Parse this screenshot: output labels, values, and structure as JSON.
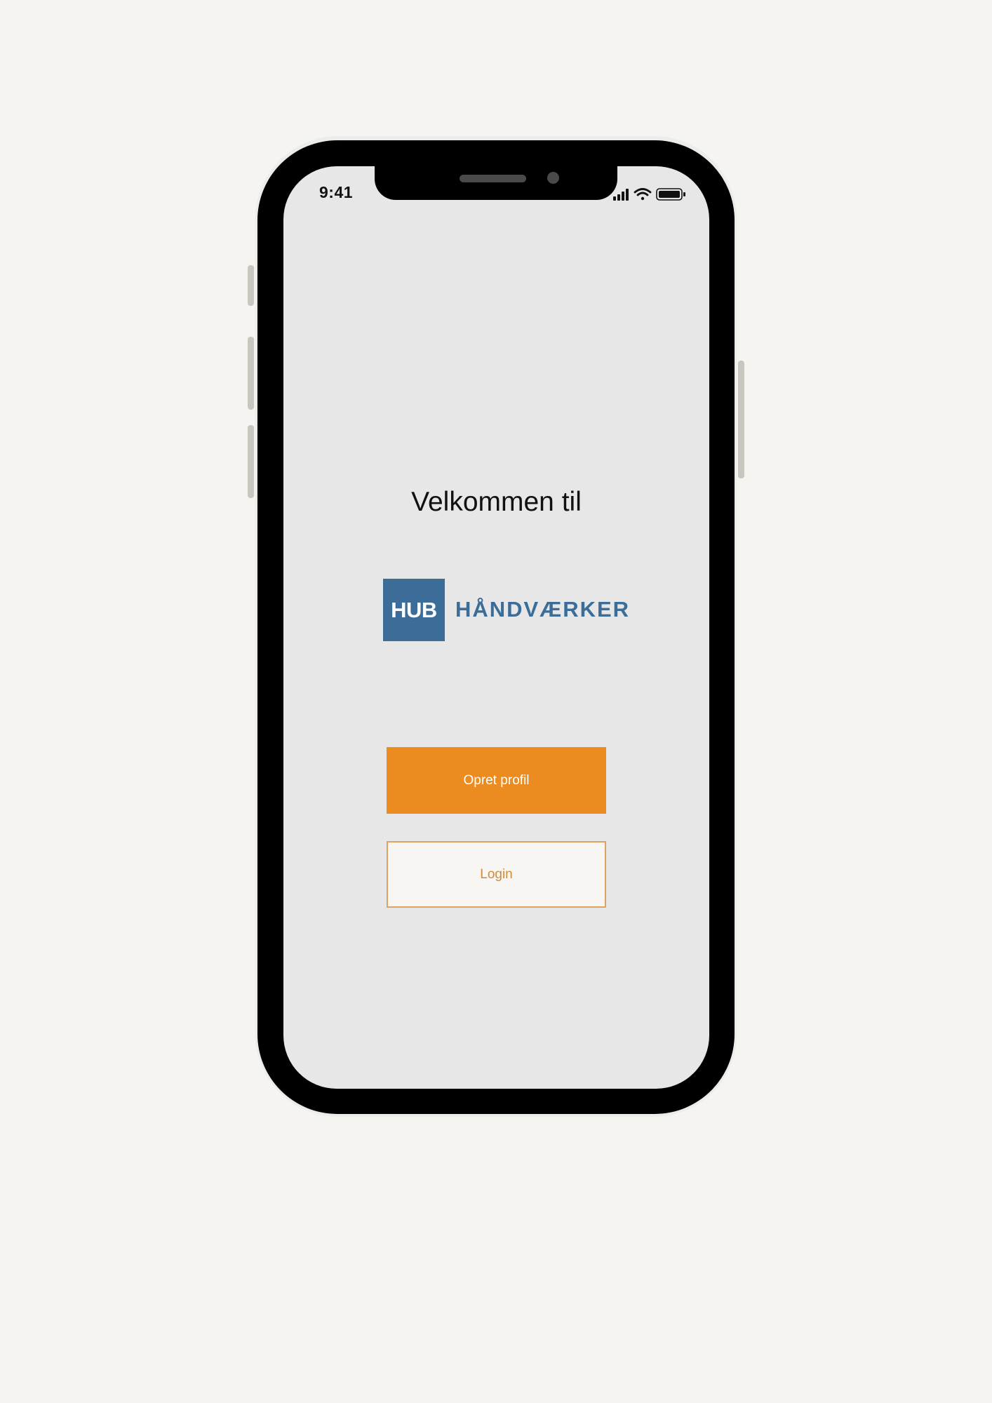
{
  "status_bar": {
    "time": "9:41",
    "icons": [
      "signal-icon",
      "wifi-icon",
      "battery-icon"
    ]
  },
  "welcome": {
    "title": "Velkommen til"
  },
  "logo": {
    "mark": "HUB",
    "wordmark": "HÅNDVÆRKER",
    "color": "#3b6d98"
  },
  "actions": {
    "create_profile_label": "Opret profil",
    "login_label": "Login"
  },
  "colors": {
    "accent": "#ec8b1f",
    "brand": "#3b6d98",
    "screen_background": "#e7e7e8",
    "page_background": "#f5f4f1"
  }
}
